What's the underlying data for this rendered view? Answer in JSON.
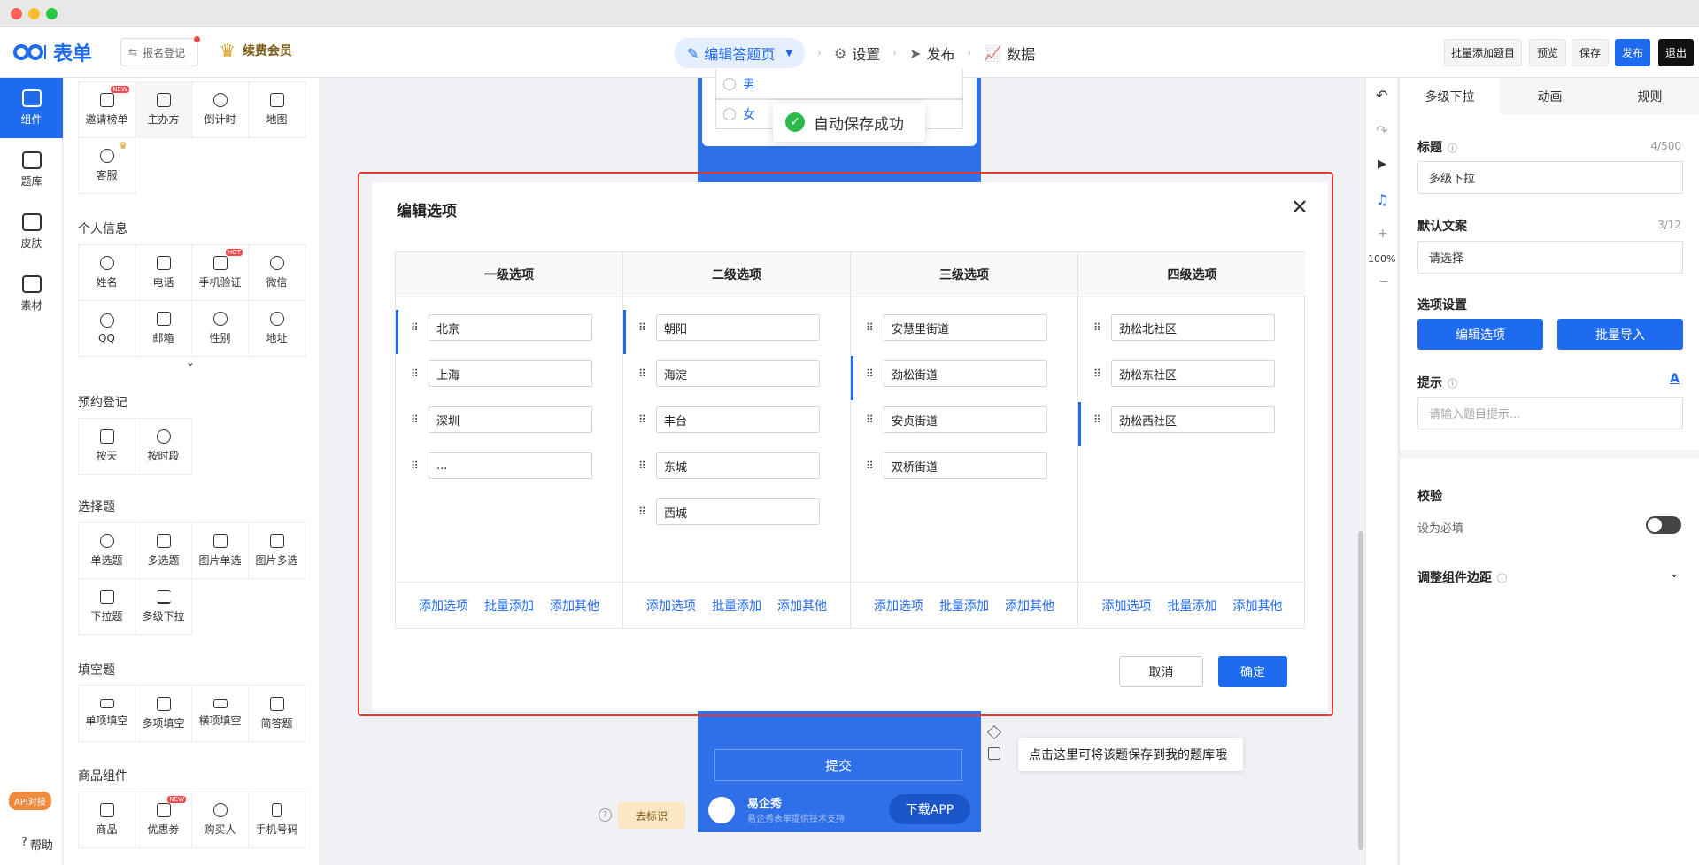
{
  "header": {
    "logo_text": "表单",
    "signin_label": "报名登记",
    "vip_label": "续费会员",
    "steps": [
      "编辑答题页",
      "设置",
      "发布",
      "数据"
    ],
    "buttons": {
      "batch_add": "批量添加题目",
      "preview": "预览",
      "save": "保存",
      "publish": "发布",
      "exit": "退出"
    }
  },
  "leftbar": {
    "items": [
      "组件",
      "题库",
      "皮肤",
      "素材"
    ],
    "api_badge": "API对接",
    "help": "帮助"
  },
  "panel": {
    "top_items": [
      "邀请榜单",
      "主办方",
      "倒计时",
      "地图",
      "客服"
    ],
    "personal_title": "个人信息",
    "personal_items": [
      "姓名",
      "电话",
      "手机验证",
      "微信",
      "QQ",
      "邮箱",
      "性别",
      "地址"
    ],
    "booking_title": "预约登记",
    "booking_items": [
      "按天",
      "按时段"
    ],
    "choice_title": "选择题",
    "choice_items": [
      "单选题",
      "多选题",
      "图片单选",
      "图片多选",
      "下拉题",
      "多级下拉"
    ],
    "fill_title": "填空题",
    "fill_items": [
      "单项填空",
      "多项填空",
      "横项填空",
      "简答题"
    ],
    "goods_title": "商品组件",
    "goods_items": [
      "商品",
      "优惠券",
      "购买人",
      "手机号码"
    ],
    "tags": {
      "new": "NEW",
      "hot": "HOT"
    }
  },
  "phone": {
    "options": [
      "男",
      "女"
    ],
    "submit": "提交",
    "brand_name": "易企秀",
    "brand_sub": "易企秀表单提供技术支持",
    "download": "下载APP",
    "go_mark": "去标识"
  },
  "toast": {
    "text": "自动保存成功"
  },
  "tip": {
    "text": "点击这里可将该题保存到我的题库哦"
  },
  "modal": {
    "title": "编辑选项",
    "columns": [
      {
        "header": "一级选项",
        "options": [
          "北京",
          "上海",
          "深圳",
          "..."
        ],
        "active": 0
      },
      {
        "header": "二级选项",
        "options": [
          "朝阳",
          "海淀",
          "丰台",
          "东城",
          "西城"
        ],
        "active": 0
      },
      {
        "header": "三级选项",
        "options": [
          "安慧里街道",
          "劲松街道",
          "安贞街道",
          "双桥街道"
        ],
        "active": 1
      },
      {
        "header": "四级选项",
        "options": [
          "劲松北社区",
          "劲松东社区",
          "劲松西社区"
        ],
        "active": 2
      }
    ],
    "footer_links": [
      "添加选项",
      "批量添加",
      "添加其他"
    ],
    "cancel": "取消",
    "confirm": "确定"
  },
  "zoom": "100%",
  "right_panel": {
    "tabs": [
      "多级下拉",
      "动画",
      "规则"
    ],
    "title_label": "标题",
    "title_count": "4/500",
    "title_value": "多级下拉",
    "default_label": "默认文案",
    "default_count": "3/12",
    "default_value": "请选择",
    "options_label": "选项设置",
    "edit_options": "编辑选项",
    "batch_import": "批量导入",
    "hint_label": "提示",
    "hint_placeholder": "请输入题目提示...",
    "validate_label": "校验",
    "required_label": "设为必填",
    "margin_label": "调整组件边距"
  },
  "colors": {
    "primary": "#1f6bf0",
    "danger": "#e53935",
    "success": "#2fb94a"
  }
}
